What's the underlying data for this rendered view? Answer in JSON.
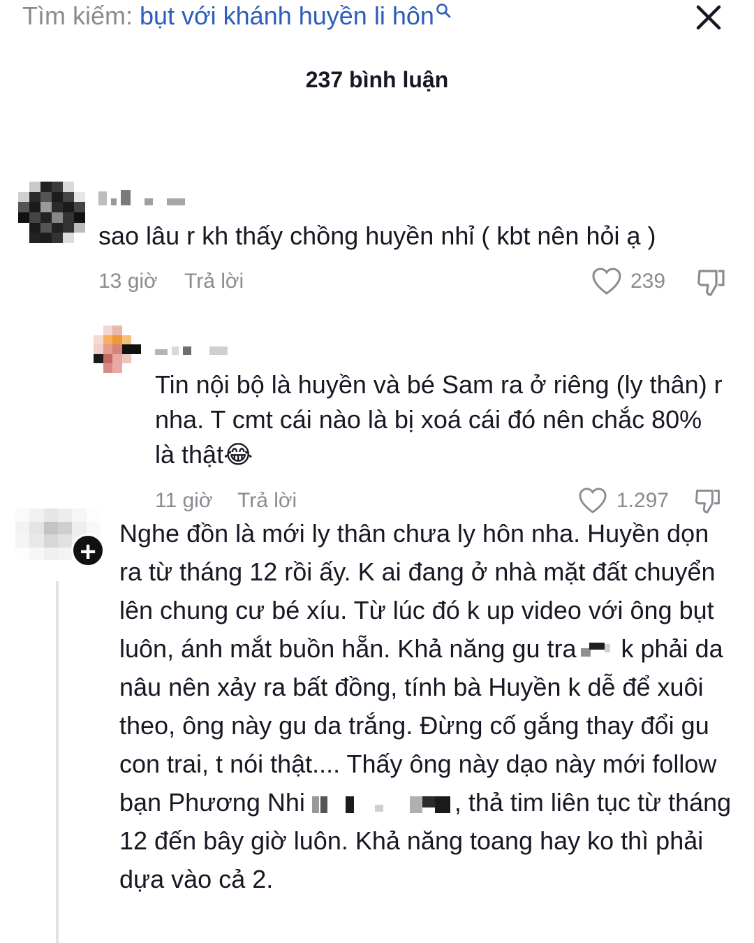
{
  "search": {
    "prefix": "Tìm kiếm:",
    "query": "bụt với khánh huyền li hôn"
  },
  "header": {
    "comment_count": "237 bình luận"
  },
  "comments": [
    {
      "text": "sao lâu r kh thấy chồng huyền nhỉ ( kbt nên hỏi ạ )",
      "time": "13 giờ",
      "reply_label": "Trả lời",
      "likes": "239"
    },
    {
      "text": "Tin nội bộ là huyền và bé Sam ra ở riêng (ly thân) r nha. T cmt cái nào là bị xoá cái đó nên chắc 80% là thật😂",
      "time": "11 giờ",
      "reply_label": "Trả lời",
      "likes": "1.297"
    },
    {
      "part1": "Nghe đồn là mới ly thân chưa ly hôn nha. Huyền dọn ra từ tháng 12 rồi ấy. K ai đang ở nhà mặt đất chuyển lên chung cư bé xíu. Từ lúc đó k up video với ông bụt luôn,  ánh mắt buồn hẵn. Khả năng gu tra",
      "part2": " k phải da nâu nên xảy ra bất đồng, tính bà Huyền k dễ để xuôi theo, ông này gu da trắng. Đừng cố gắng thay đổi gu con trai, t nói thật.... Thấy ông này dạo này mới follow bạn Phương Nhi ",
      "part3": ", thả tim liên tục từ tháng 12 đến bây giờ luôn. Khả năng toang hay ko thì phải dựa vào cả 2."
    }
  ],
  "icons": {
    "close": "close-icon",
    "search": "search-icon",
    "like": "heart-outline-icon",
    "dislike": "thumbs-down-icon",
    "follow": "plus-icon"
  },
  "colors": {
    "query": "#2b5db9",
    "muted": "#8a8b91",
    "text": "#161823"
  }
}
